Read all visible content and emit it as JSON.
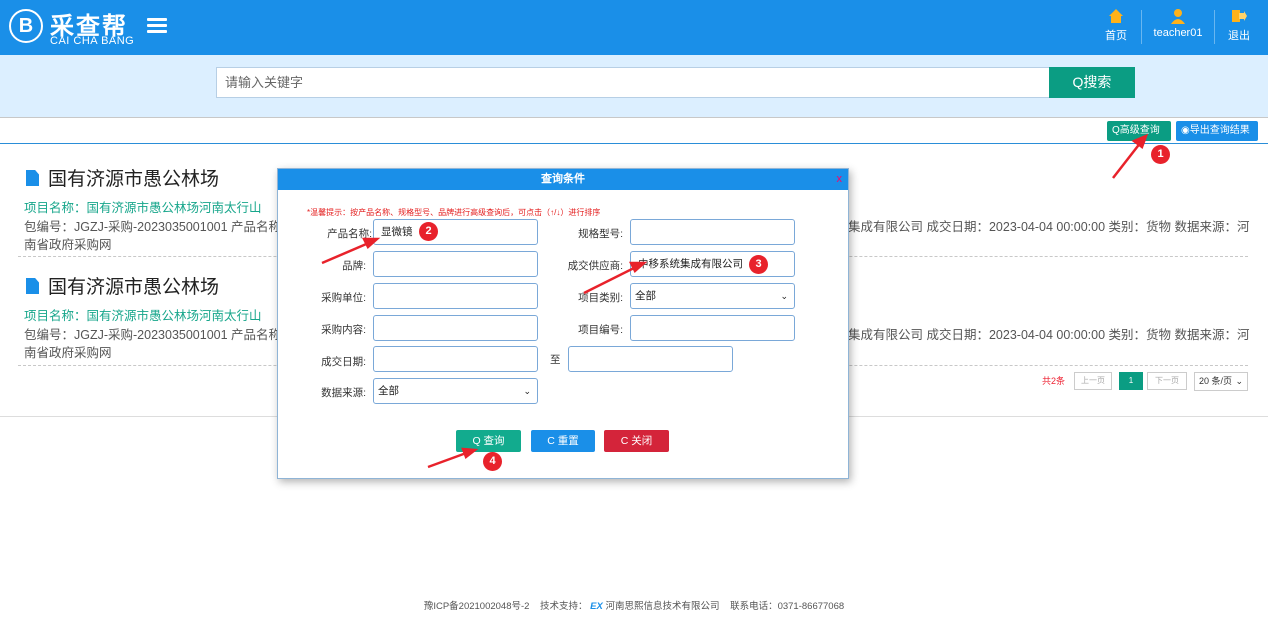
{
  "header": {
    "logo_glyph": "B",
    "logo_cn": "采查帮",
    "logo_en": "CAI CHA BANG",
    "nav": [
      {
        "label": "首页",
        "icon": "home-icon"
      },
      {
        "label": "teacher01",
        "icon": "user-icon"
      },
      {
        "label": "退出",
        "icon": "logout-icon"
      }
    ]
  },
  "search": {
    "placeholder": "请输入关键字",
    "button_label": "Q搜索"
  },
  "toolbar": {
    "advanced_label": "Q高级查询",
    "export_label": "◉导出查询结果"
  },
  "results": [
    {
      "title": "国有济源市愚公林场",
      "project_line": "项目名称：国有济源市愚公林场河南太行山",
      "meta_left": "包编号：JGZJ-采购-2023035001001 产品名称：",
      "meta_right": "集成有限公司 成交日期：2023-04-04 00:00:00 类别：货物 数据来源：河",
      "meta_wrap": "南省政府采购网"
    },
    {
      "title": "国有济源市愚公林场",
      "project_line": "项目名称：国有济源市愚公林场河南太行山",
      "meta_left": "包编号：JGZJ-采购-2023035001001 产品名称：",
      "meta_right": "集成有限公司 成交日期：2023-04-04 00:00:00 类别：货物 数据来源：河",
      "meta_wrap": "南省政府采购网"
    }
  ],
  "pager": {
    "total": "共2条",
    "prev": "上一页",
    "current": "1",
    "next": "下一页",
    "page_size": "20 条/页"
  },
  "modal": {
    "title": "查询条件",
    "close": "x",
    "tip": "*温馨提示：按产品名称、规格型号、品牌进行高级查询后，可点击（↑/↓）进行排序",
    "fields": {
      "product_name": {
        "label": "产品名称:",
        "value": "显微镜"
      },
      "spec_model": {
        "label": "规格型号:",
        "value": ""
      },
      "brand": {
        "label": "品牌:",
        "value": ""
      },
      "supplier": {
        "label": "成交供应商:",
        "value": "中移系统集成有限公司"
      },
      "purchaser": {
        "label": "采购单位:",
        "value": ""
      },
      "project_type": {
        "label": "项目类别:",
        "value": "全部"
      },
      "content": {
        "label": "采购内容:",
        "value": ""
      },
      "project_no": {
        "label": "项目编号:",
        "value": ""
      },
      "deal_date": {
        "label": "成交日期:",
        "to": "至"
      },
      "source": {
        "label": "数据来源:",
        "value": "全部"
      }
    },
    "buttons": {
      "query": "Q 查询",
      "reset": "C 重置",
      "close": "C 关闭"
    }
  },
  "annotations": [
    "1",
    "2",
    "3",
    "4"
  ],
  "footer": {
    "icp": "豫ICP备2021002048号-2",
    "support_label": "技术支持：",
    "support_logo": "EX",
    "support_company": "河南思熙信息技术有限公司",
    "phone": "联系电话：0371-86677068"
  },
  "colors": {
    "primary_blue": "#1a8fe8",
    "teal": "#0b9d83",
    "red": "#d4243a",
    "annotation_red": "#e8222b"
  }
}
